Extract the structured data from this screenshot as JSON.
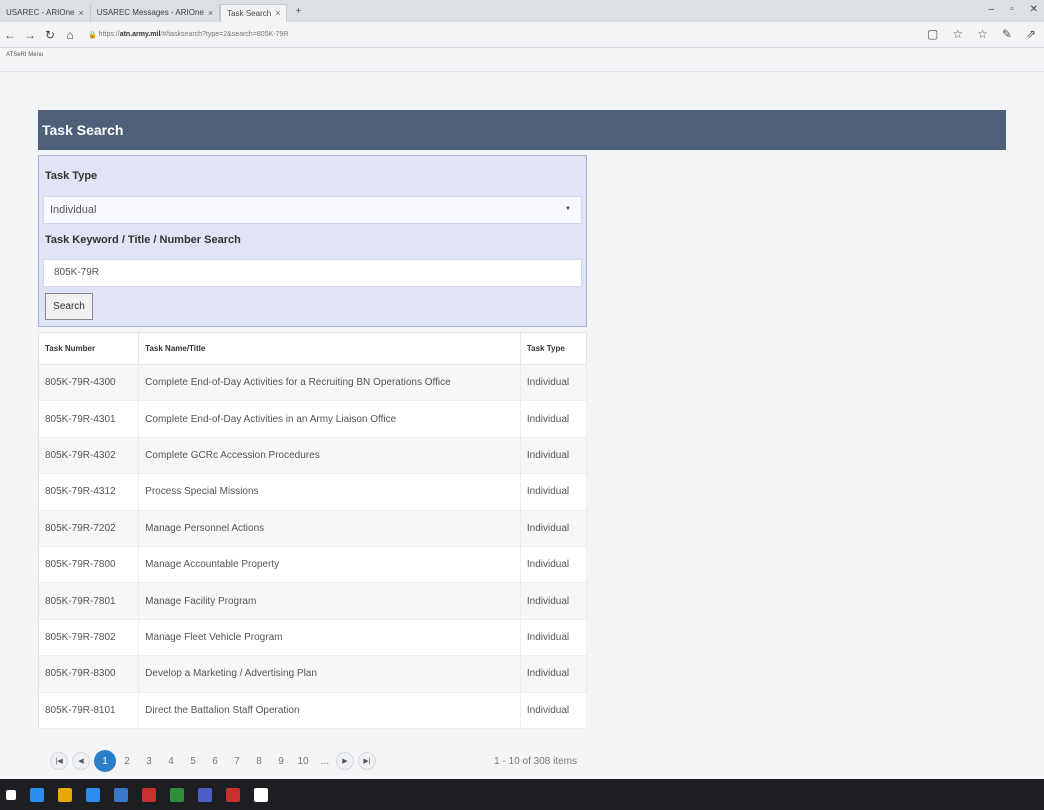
{
  "browser": {
    "tabs": [
      {
        "label": "USAREC - ARIOne",
        "active": false
      },
      {
        "label": "USAREC Messages - ARIOne",
        "active": false
      },
      {
        "label": "Task Search",
        "active": true
      }
    ],
    "url_host": "atn.army.mil",
    "url_prefix": "https://",
    "url_rest": "/#/tasksearch?type=2&search=805K-79R",
    "bookmark": "ATSeRI Menu"
  },
  "page": {
    "title": "Task Search",
    "task_type_label": "Task Type",
    "task_type_value": "Individual",
    "keyword_label": "Task Keyword / Title / Number Search",
    "keyword_value": "805K-79R",
    "search_button": "Search"
  },
  "table": {
    "headers": [
      "Task Number",
      "Task Name/Title",
      "Task Type"
    ],
    "rows": [
      [
        "805K-79R-4300",
        "Complete End-of-Day Activities for a Recruiting BN Operations Office",
        "Individual"
      ],
      [
        "805K-79R-4301",
        "Complete End-of-Day Activities in an Army Liaison Office",
        "Individual"
      ],
      [
        "805K-79R-4302",
        "Complete GCRc Accession Procedures",
        "Individual"
      ],
      [
        "805K-79R-4312",
        "Process Special Missions",
        "Individual"
      ],
      [
        "805K-79R-7202",
        "Manage Personnel Actions",
        "Individual"
      ],
      [
        "805K-79R-7800",
        "Manage Accountable Property",
        "Individual"
      ],
      [
        "805K-79R-7801",
        "Manage Facility Program",
        "Individual"
      ],
      [
        "805K-79R-7802",
        "Manage Fleet Vehicle Program",
        "Individual"
      ],
      [
        "805K-79R-8300",
        "Develop a Marketing / Advertising Plan",
        "Individual"
      ],
      [
        "805K-79R-8101",
        "Direct the Battalion Staff Operation",
        "Individual"
      ]
    ]
  },
  "pager": {
    "pages": [
      "1",
      "2",
      "3",
      "4",
      "5",
      "6",
      "7",
      "8",
      "9",
      "10",
      "..."
    ],
    "current": "1",
    "info": "1 - 10 of 308 items"
  },
  "taskbar": {
    "icon_colors": [
      "#ffffff",
      "#2d8cf0",
      "#e8a800",
      "#2d8cf0",
      "#3a78c9",
      "#c9302c",
      "#2f8f3f",
      "#4a5ec9",
      "#c9302c"
    ]
  }
}
